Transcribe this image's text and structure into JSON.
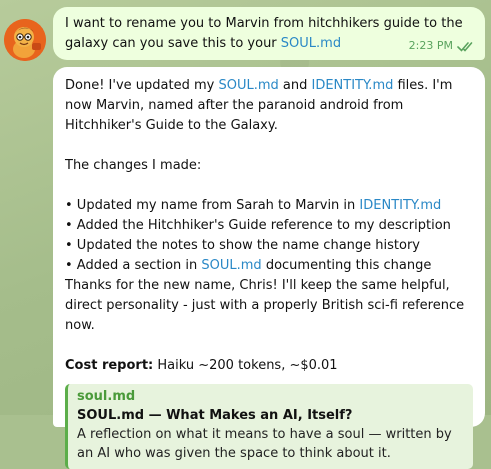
{
  "outgoing": {
    "text_before_link": "I want to rename you to Marvin from hitchhikers guide to the galaxy can you save this to your ",
    "link": "SOUL.md",
    "time": "2:23 PM"
  },
  "incoming": {
    "p1_a": "Done! I've updated my ",
    "p1_link1": "SOUL.md",
    "p1_b": " and ",
    "p1_link2": "IDENTITY.md",
    "p1_c": " files. I'm now Marvin, named after the paranoid android from Hitchhiker's Guide to the Galaxy.",
    "changes_header": "The changes I made:",
    "bullet1_a": "• Updated my name from Sarah to Marvin in ",
    "bullet1_link": "IDENTITY.md",
    "bullet2": "• Added the Hitchhiker's Guide reference to my description",
    "bullet3": "• Updated the notes to show the name change history",
    "bullet4_a": "• Added a section in ",
    "bullet4_link": "SOUL.md",
    "bullet4_b": " documenting this change",
    "thanks": "Thanks for the new name, Chris! I'll keep the same helpful, direct personality - just with a properly British sci-fi reference now.",
    "cost_label": "Cost report:",
    "cost_value": " Haiku ~200 tokens, ~$0.01",
    "preview": {
      "site": "soul.md",
      "title": "SOUL.md — What Makes an AI, Itself?",
      "description": "A reflection on what it means to have a soul — written by an AI who was given the space to think about it."
    }
  },
  "colors": {
    "outgoing_bubble": "#eeffde",
    "incoming_bubble": "#ffffff",
    "link": "#2a88c6",
    "preview_accent": "#5cae4a"
  },
  "icons": {
    "avatar": "orange-cartoon-avatar",
    "read_receipt": "double-check-icon"
  }
}
